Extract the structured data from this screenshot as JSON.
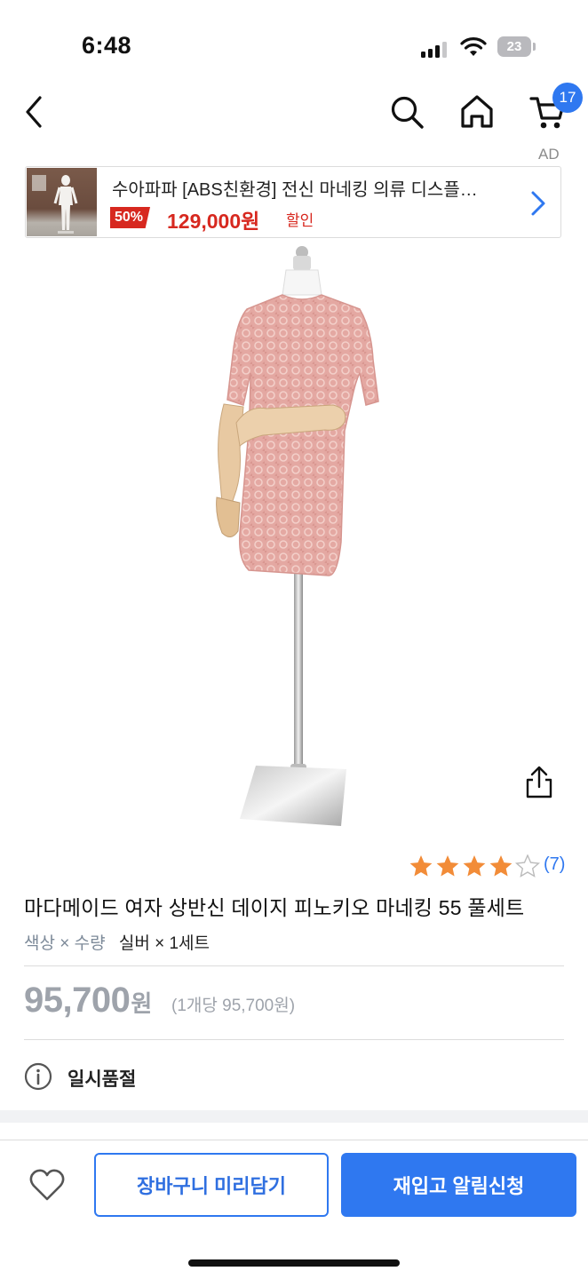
{
  "status_bar": {
    "time": "6:48",
    "battery": "23",
    "signal_icon": "cellular-signal-icon",
    "wifi_icon": "wifi-icon"
  },
  "nav": {
    "cart_count": "17",
    "icons": [
      "back-arrow-icon",
      "search-icon",
      "home-icon",
      "cart-icon"
    ]
  },
  "ad": {
    "label": "AD",
    "title": "수아파파 [ABS친환경] 전신 마네킹 의류 디스플…",
    "discount": "50%",
    "price": "129,000원",
    "sale_label": "할인"
  },
  "product": {
    "rating": 4,
    "rating_max": 5,
    "review_count": "(7)",
    "title": "마다메이드 여자 상반신 데이지 피노키오 마네킹 55 풀세트",
    "option_label": "색상 × 수량",
    "option_value": "실버 × 1세트",
    "price": "95,700",
    "price_unit": "원",
    "unit_price": "(1개당 95,700원)",
    "status": "일시품절"
  },
  "actions": {
    "cart_button": "장바구니 미리담기",
    "restock_button": "재입고 알림신청"
  },
  "colors": {
    "accent": "#2f78f0",
    "sale_red": "#d7281f",
    "star": "#f28c38"
  }
}
